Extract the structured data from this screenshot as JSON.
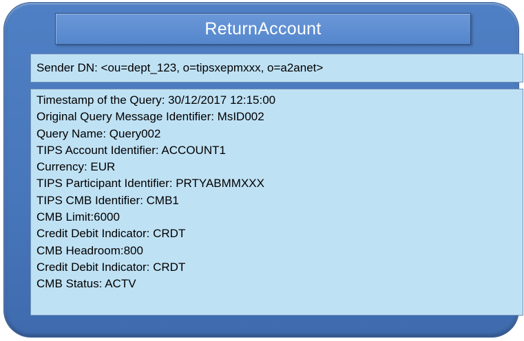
{
  "title": "ReturnAccount",
  "sender": "Sender DN: <ou=dept_123, o=tipsxepmxxx, o=a2anet>",
  "details": [
    "Timestamp of the Query: 30/12/2017 12:15:00",
    "Original Query Message Identifier: MsID002",
    "Query Name: Query002",
    "TIPS Account Identifier: ACCOUNT1",
    "Currency: EUR",
    "TIPS Participant Identifier: PRTYABMMXXX",
    "TIPS CMB Identifier: CMB1",
    "CMB Limit:6000",
    "Credit Debit Indicator: CRDT",
    "CMB Headroom:800",
    "Credit Debit Indicator: CRDT",
    "CMB Status: ACTV"
  ],
  "colors": {
    "frame": "#4877bb",
    "title_bar": "#5b8bcf",
    "box_fill": "#bfe1f4"
  }
}
